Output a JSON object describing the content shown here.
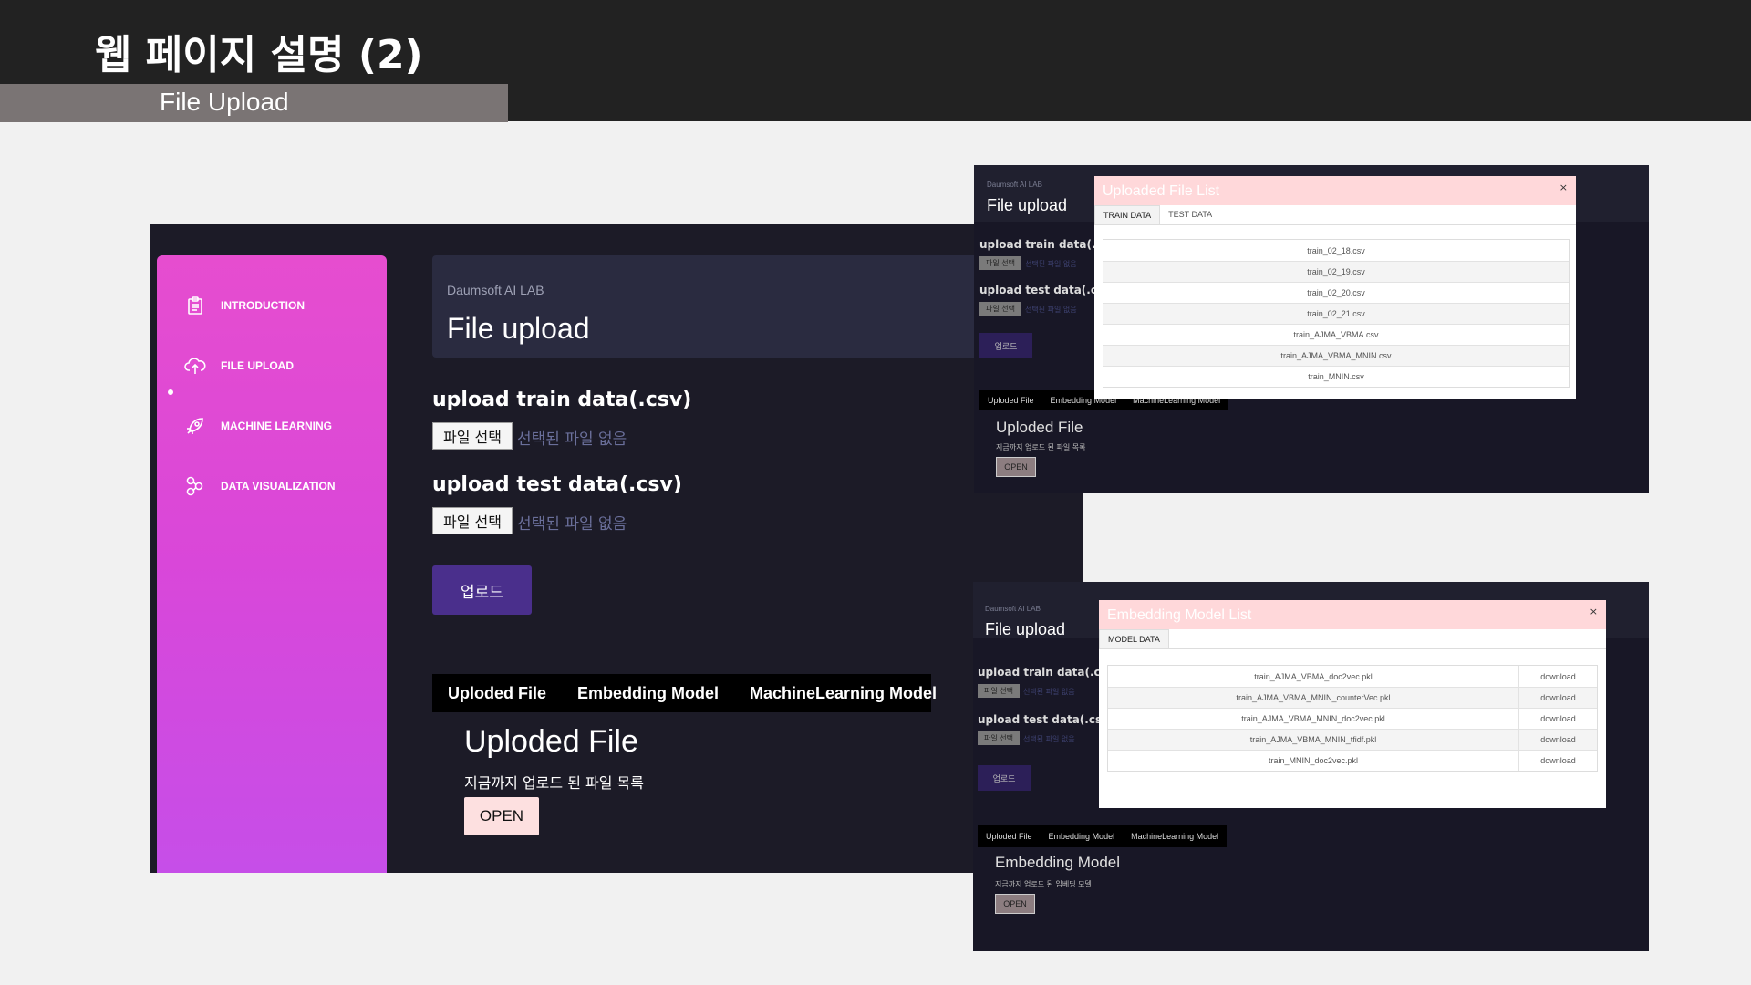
{
  "slide": {
    "title": "웹 페이지 설명 (2)",
    "subtitle": "File Upload"
  },
  "main": {
    "nav": [
      {
        "label": "INTRODUCTION",
        "icon": "clipboard-icon"
      },
      {
        "label": "FILE UPLOAD",
        "icon": "cloud-upload-icon",
        "active": true
      },
      {
        "label": "MACHINE LEARNING",
        "icon": "rocket-icon"
      },
      {
        "label": "DATA VISUALIZATION",
        "icon": "molecule-icon"
      }
    ],
    "brand": "Daumsoft AI LAB",
    "page_title": "File upload",
    "train_label": "upload train data(.csv)",
    "test_label": "upload test data(.csv)",
    "choose_file": "파일 선택",
    "no_file": "선택된 파일 없음",
    "upload_button": "업로드",
    "tabs": [
      "Uploded File",
      "Embedding Model",
      "MachineLearning Model"
    ],
    "section_title": "Uploded File",
    "section_desc": "지금까지 업로드 된 파일 목록",
    "open_button": "OPEN"
  },
  "shot1": {
    "brand": "Daumsoft AI LAB",
    "page_title": "File upload",
    "train_label": "upload train data(.csv",
    "test_label": "upload test data(.csv",
    "choose_file": "파일 선택",
    "no_file": "선택된 파일 없음",
    "upload_button": "업로드",
    "tabs": [
      "Uploded File",
      "Embedding Model",
      "MachineLearning Model"
    ],
    "section_title": "Uploded File",
    "section_desc": "지금까지 업로드 된 파일 목록",
    "open_button": "OPEN",
    "modal": {
      "title": "Uploaded File List",
      "close": "×",
      "tabs": [
        "TRAIN DATA",
        "TEST DATA"
      ],
      "files": [
        "train_02_18.csv",
        "train_02_19.csv",
        "train_02_20.csv",
        "train_02_21.csv",
        "train_AJMA_VBMA.csv",
        "train_AJMA_VBMA_MNIN.csv",
        "train_MNIN.csv"
      ]
    }
  },
  "shot2": {
    "brand": "Daumsoft AI LAB",
    "page_title": "File upload",
    "train_label": "upload train data(.csv",
    "test_label": "upload test data(.csv",
    "choose_file": "파일 선택",
    "no_file": "선택된 파일 없음",
    "upload_button": "업로드",
    "tabs": [
      "Uploded File",
      "Embedding Model",
      "MachineLearning Model"
    ],
    "section_title": "Embedding Model",
    "section_desc": "지금까지 업로드 된 임베딩 모델",
    "open_button": "OPEN",
    "modal": {
      "title": "Embedding Model List",
      "close": "×",
      "tabs": [
        "MODEL DATA"
      ],
      "download": "download",
      "files": [
        "train_AJMA_VBMA_doc2vec.pkl",
        "train_AJMA_VBMA_MNIN_counterVec.pkl",
        "train_AJMA_VBMA_MNIN_doc2vec.pkl",
        "train_AJMA_VBMA_MNIN_tfidf.pkl",
        "train_MNIN_doc2vec.pkl"
      ]
    }
  }
}
